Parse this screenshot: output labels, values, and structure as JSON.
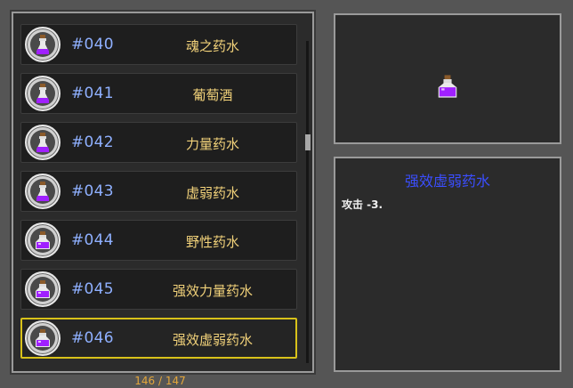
{
  "list": {
    "items": [
      {
        "number": "#040",
        "name": "魂之药水",
        "icon": "tall-potion-icon",
        "selected": false
      },
      {
        "number": "#041",
        "name": "葡萄酒",
        "icon": "tall-potion-icon",
        "selected": false
      },
      {
        "number": "#042",
        "name": "力量药水",
        "icon": "tall-potion-icon",
        "selected": false
      },
      {
        "number": "#043",
        "name": "虚弱药水",
        "icon": "tall-potion-icon",
        "selected": false
      },
      {
        "number": "#044",
        "name": "野性药水",
        "icon": "round-potion-icon",
        "selected": false
      },
      {
        "number": "#045",
        "name": "强效力量药水",
        "icon": "round-potion-icon",
        "selected": false
      },
      {
        "number": "#046",
        "name": "强效虚弱药水",
        "icon": "round-potion-icon",
        "selected": true
      }
    ],
    "counter": "146 / 147"
  },
  "detail": {
    "title": "强效虚弱药水",
    "description": "攻击 -3.",
    "icon": "round-potion-icon"
  },
  "colors": {
    "potion": "#a020ff",
    "number": "#8fb0ff",
    "name": "#f2d27a",
    "title": "#3b4eff",
    "selection": "#d8c21a",
    "counter": "#e3a63b"
  }
}
